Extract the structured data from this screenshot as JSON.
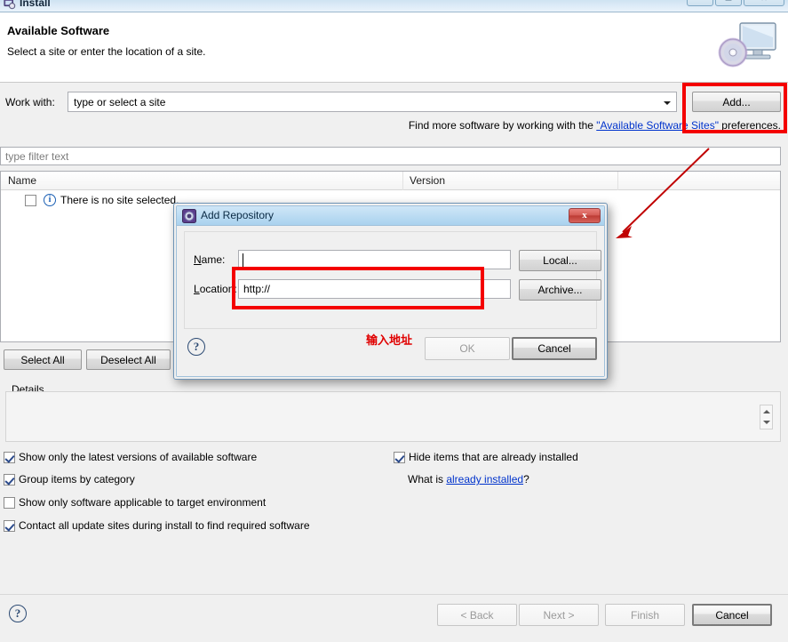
{
  "window": {
    "title": "Install",
    "icon": "install-wizard-icon",
    "controls": [
      {
        "name": "minimize",
        "glyph": "—"
      },
      {
        "name": "maximize",
        "glyph": "▭"
      },
      {
        "name": "close",
        "glyph": "✕"
      }
    ]
  },
  "header": {
    "title": "Available Software",
    "subtitle": "Select a site or enter the location of a site.",
    "icon": "monitor-cd-icon"
  },
  "work_with": {
    "label": "Work with:",
    "value": "type or select a site",
    "placeholder": "type or select a site",
    "dropdown_icon": "chevron-down-icon",
    "add_button": "Add..."
  },
  "find_more": {
    "prefix": "Find more software by working with the ",
    "link": "\"Available Software Sites\"",
    "suffix": " preferences."
  },
  "filter": {
    "placeholder": "type filter text",
    "value": ""
  },
  "table": {
    "columns": [
      "Name",
      "Version"
    ],
    "rows": [
      {
        "checked": false,
        "icon": "info-icon",
        "name": "There is no site selected.",
        "version": ""
      }
    ]
  },
  "selection_buttons": {
    "select_all": "Select All",
    "deselect_all": "Deselect All"
  },
  "details": {
    "label": "Details",
    "text": "",
    "spinner_icon": "spinner-arrows-icon"
  },
  "options_left": [
    {
      "label": "Show only the latest versions of available software",
      "checked": true
    },
    {
      "label": "Group items by category",
      "checked": true
    },
    {
      "label": "Show only software applicable to target environment",
      "checked": false
    },
    {
      "label": "Contact all update sites during install to find required software",
      "checked": true
    }
  ],
  "options_right": [
    {
      "label": "Hide items that are already installed",
      "checked": true
    }
  ],
  "what_is": {
    "prefix": "What is ",
    "link": "already installed",
    "suffix": "?"
  },
  "footer": {
    "help_icon": "help-question-icon",
    "buttons": [
      {
        "label": "< Back",
        "enabled": false
      },
      {
        "label": "Next >",
        "enabled": false
      },
      {
        "label": "Finish",
        "enabled": false
      },
      {
        "label": "Cancel",
        "enabled": true
      }
    ]
  },
  "dialog": {
    "title": "Add Repository",
    "title_icon": "repository-gear-icon",
    "close_glyph": "x",
    "name_label": "Name:",
    "name_label_mnemonic": "N",
    "name_value": "",
    "location_label": "Location:",
    "location_label_mnemonic": "L",
    "location_value": "http://",
    "local_button": "Local...",
    "archive_button": "Archive...",
    "help_icon": "help-question-icon",
    "ok_button": "OK",
    "ok_enabled": false,
    "cancel_button": "Cancel",
    "annotation": "输入地址"
  },
  "annotations": {
    "highlight_color": "#f40000",
    "rect_add_button": "red-rectangle-around-add-button",
    "rect_location_field": "red-rectangle-around-location-field",
    "arrow": "red-arrow-pointing-to-dialog"
  }
}
